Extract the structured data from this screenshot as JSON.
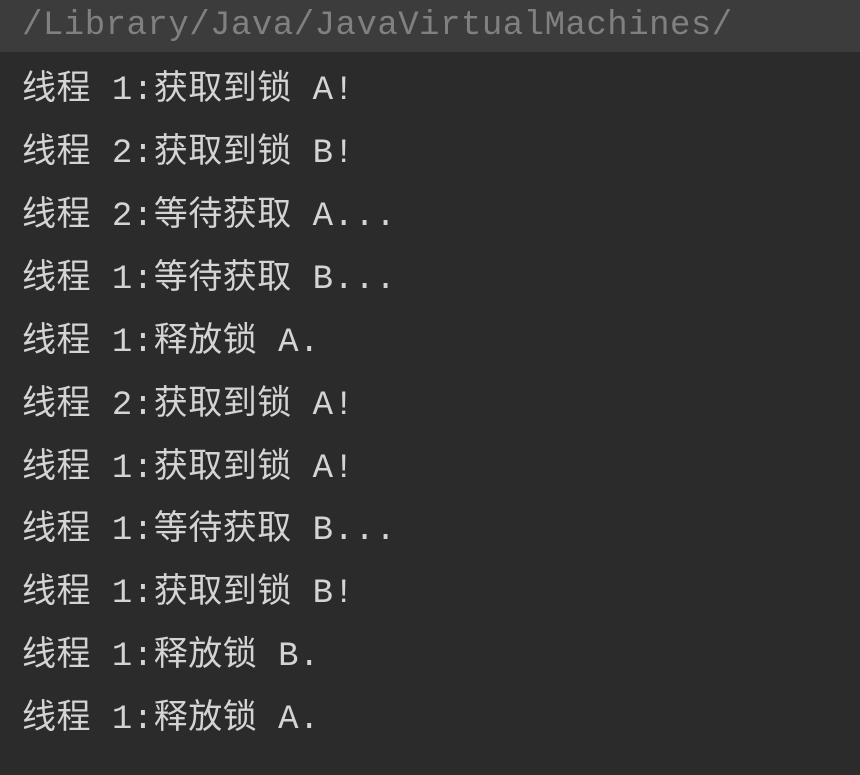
{
  "console": {
    "command": "/Library/Java/JavaVirtualMachines/",
    "lines": [
      "线程 1:获取到锁 A!",
      "线程 2:获取到锁 B!",
      "线程 2:等待获取 A...",
      "线程 1:等待获取 B...",
      "线程 1:释放锁 A.",
      "线程 2:获取到锁 A!",
      "线程 1:获取到锁 A!",
      "线程 1:等待获取 B...",
      "线程 1:获取到锁 B!",
      "线程 1:释放锁 B.",
      "线程 1:释放锁 A."
    ]
  }
}
